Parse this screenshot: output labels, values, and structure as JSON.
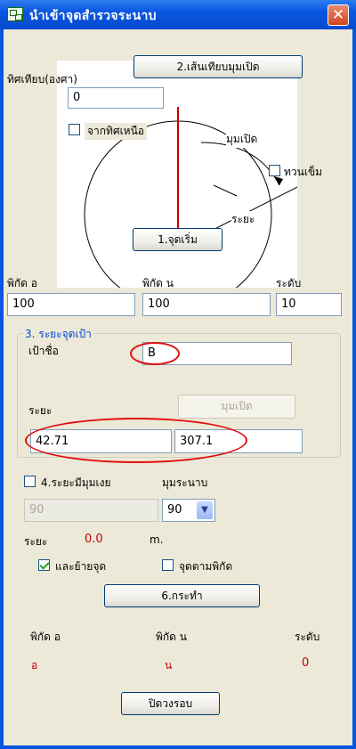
{
  "window": {
    "title": "นำเข้าจุดสำรวจระนาบ",
    "close": "✕"
  },
  "bearing": {
    "label": "ทิศเทียบ(องศา)",
    "value": "0",
    "from_north_label": "จากทิศเหนือ",
    "from_north_checked": false,
    "counterclockwise_label": "ทวนเข็ม",
    "counterclockwise_checked": false,
    "diagram": {
      "angle_label": "มุมเปิด",
      "distance_label": "ระยะ"
    },
    "button2_label": "2.เส้นเทียบมุมเปิด",
    "button1_label": "1.จุดเริ่ม"
  },
  "coords": {
    "e_label": "พิกัด อ",
    "n_label": "พิกัด น",
    "level_label": "ระดับ",
    "e_value": "100",
    "n_value": "100",
    "level_value": "10"
  },
  "target": {
    "group_title": "3. ระยะจุดเป้า",
    "name_label": "เป้าชื่อ",
    "name_value": "B",
    "distance_label": "ระยะ",
    "angle_button_label": "มุมเปิด",
    "distance_value": "42.71",
    "angle_value": "307.1"
  },
  "slope": {
    "checkbox_label": "4.ระยะมีมุมเงย",
    "checked": false,
    "angle_label": "มุมระนาบ",
    "input_value": "90",
    "select_value": "90",
    "distance_label": "ระยะ",
    "distance_value": "0.0",
    "unit": "m."
  },
  "options": {
    "move_point_label": "และย้ายจุด",
    "move_point_checked": true,
    "point_by_coord_label": "จุดตามพิกัด",
    "point_by_coord_checked": false
  },
  "action_button_label": "6.กระทำ",
  "result": {
    "e_label": "พิกัด อ",
    "n_label": "พิกัด น",
    "level_label": "ระดับ",
    "e_value": "อ",
    "n_value": "น",
    "level_value": "0"
  },
  "close_button_label": "ปิดวงรอบ",
  "colors": {
    "titlebar": "#0a55e2",
    "panel": "#ece9d8",
    "accent_red": "#c00000",
    "group_title": "#0046d5"
  }
}
